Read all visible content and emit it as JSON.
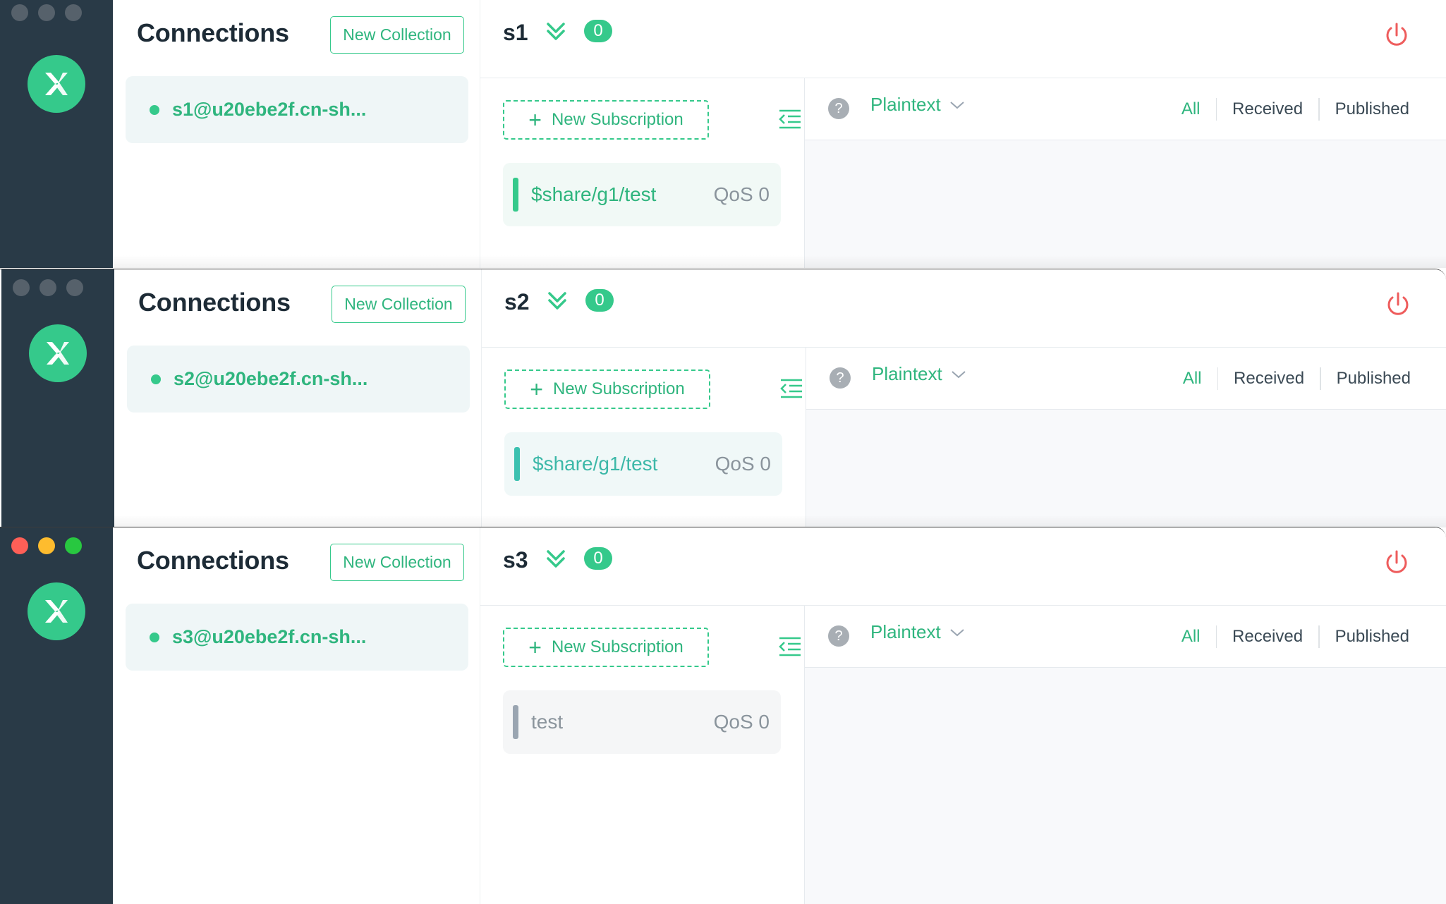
{
  "colors": {
    "accent": "#35c98b",
    "accent_text": "#2fb57e",
    "rail": "#293a47",
    "danger": "#ee5c5c",
    "inactive_bar": "#9aa5b1"
  },
  "windows": [
    {
      "connections_title": "Connections",
      "new_collection_label": "New Collection",
      "connection_name": "s1@u20ebe2f.cn-sh...",
      "header_title": "s1",
      "unread_count": "0",
      "new_subscription_label": "New Subscription",
      "subscription": {
        "topic": "$share/g1/test",
        "qos": "QoS 0"
      },
      "payload_format": "Plaintext",
      "help_label": "?",
      "filters": [
        "All",
        "Received",
        "Published"
      ]
    },
    {
      "connections_title": "Connections",
      "new_collection_label": "New Collection",
      "connection_name": "s2@u20ebe2f.cn-sh...",
      "header_title": "s2",
      "unread_count": "0",
      "new_subscription_label": "New Subscription",
      "subscription": {
        "topic": "$share/g1/test",
        "qos": "QoS 0"
      },
      "payload_format": "Plaintext",
      "help_label": "?",
      "filters": [
        "All",
        "Received",
        "Published"
      ]
    },
    {
      "connections_title": "Connections",
      "new_collection_label": "New Collection",
      "connection_name": "s3@u20ebe2f.cn-sh...",
      "header_title": "s3",
      "unread_count": "0",
      "new_subscription_label": "New Subscription",
      "subscription": {
        "topic": "test",
        "qos": "QoS 0"
      },
      "payload_format": "Plaintext",
      "help_label": "?",
      "filters": [
        "All",
        "Received",
        "Published"
      ]
    }
  ]
}
